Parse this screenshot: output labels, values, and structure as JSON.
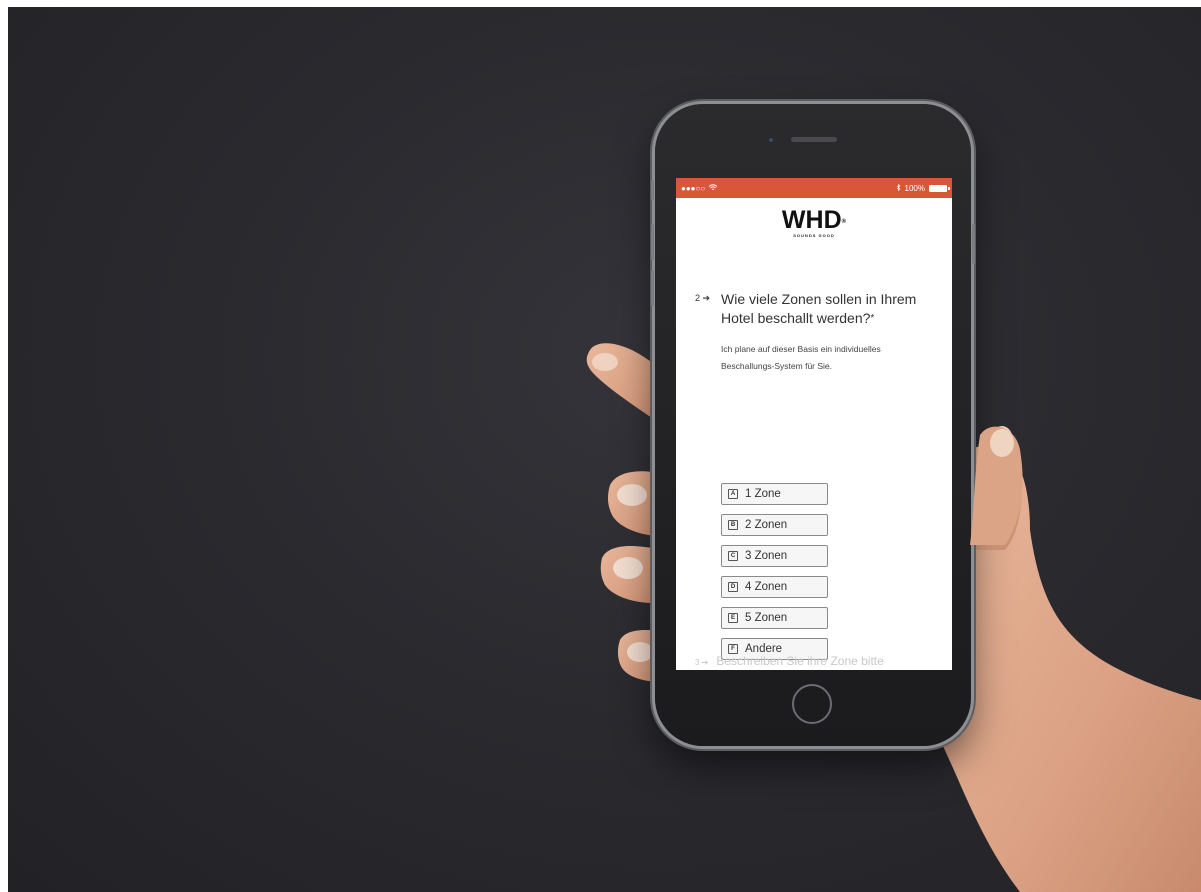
{
  "status_bar": {
    "signal": "●●●○○",
    "battery": "100%",
    "accent": "#d8573a"
  },
  "logo": {
    "brand": "WHD",
    "trademark": "®",
    "tagline": "SOUNDS GOOD"
  },
  "question": {
    "number": "2 ➔",
    "text": "Wie viele Zonen sollen in Ihrem Hotel beschallt werden?",
    "required_marker": "*",
    "description": "Ich plane auf dieser Basis ein individuelles Beschallungs-System für Sie."
  },
  "options": [
    {
      "key": "A",
      "label": "1 Zone"
    },
    {
      "key": "B",
      "label": "2 Zonen"
    },
    {
      "key": "C",
      "label": "3 Zonen"
    },
    {
      "key": "D",
      "label": "4 Zonen"
    },
    {
      "key": "E",
      "label": "5 Zonen"
    },
    {
      "key": "F",
      "label": "Andere"
    }
  ],
  "next_question": {
    "number": "3 ➔",
    "text": "Beschreiben Sie ihre Zone bitte"
  }
}
